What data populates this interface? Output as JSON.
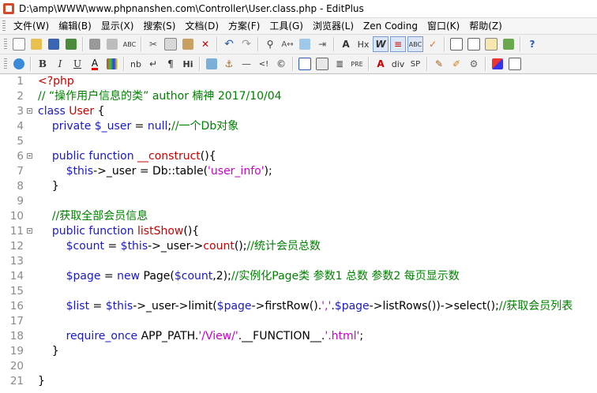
{
  "window": {
    "title": "D:\\amp\\WWW\\www.phpnanshen.com\\Controller\\User.class.php - EditPlus"
  },
  "menu": [
    {
      "label": "文件(W)"
    },
    {
      "label": "编辑(B)"
    },
    {
      "label": "显示(X)"
    },
    {
      "label": "搜索(S)"
    },
    {
      "label": "文档(D)"
    },
    {
      "label": "方案(F)"
    },
    {
      "label": "工具(G)"
    },
    {
      "label": "浏览器(L)"
    },
    {
      "label": "Zen Coding"
    },
    {
      "label": "窗口(K)"
    },
    {
      "label": "帮助(Z)"
    }
  ],
  "toolbar1": [
    "new-file-icon",
    "open-file-icon",
    "save-icon",
    "save-all-icon",
    "sep",
    "print-icon",
    "print-preview-icon",
    "spell-check-icon",
    "sep",
    "cut-icon",
    "copy-icon",
    "paste-icon",
    "delete-icon",
    "sep",
    "undo-icon",
    "redo-icon",
    "sep",
    "find-icon",
    "replace-icon",
    "find-in-files-icon",
    "goto-icon",
    "sep",
    "font-size-icon",
    "hx-icon",
    "word-wrap-icon",
    "indent-icon",
    "column-icon",
    "check-icon",
    "sep",
    "document-list-icon",
    "output-window-icon",
    "cliptext-icon",
    "directory-icon",
    "sep",
    "help-icon"
  ],
  "toolbar2": [
    "browser-icon",
    "sep",
    "bold-icon",
    "italic-icon",
    "underline-icon",
    "font-color-icon",
    "color-picker-icon",
    "sep",
    "nbsp-icon",
    "br-icon",
    "paragraph-icon",
    "heading-icon",
    "sep",
    "image-icon",
    "anchor-icon",
    "hr-icon",
    "comment-icon",
    "copyright-icon",
    "sep",
    "table-icon",
    "form-icon",
    "list-icon",
    "pre-icon",
    "sep",
    "quote-icon",
    "div-icon",
    "span-icon",
    "sep",
    "edit-icon",
    "marker-icon",
    "plugin-icon",
    "sep",
    "color-chooser-icon",
    "view-icon"
  ],
  "toolbar_text": {
    "bold": "B",
    "italic": "I",
    "underline": "U",
    "font_color": "A",
    "nbsp": "nb",
    "br": "↵",
    "paragraph": "¶",
    "heading": "Hi",
    "hx": "Hx",
    "pre": "PRE",
    "quote": "A",
    "div": "div",
    "span": "SP",
    "font_size": "A",
    "abc": "ABC"
  },
  "editor": {
    "lines": [
      {
        "n": "1",
        "fold": false,
        "html": "<span class=\"op\">&lt;?php</span>"
      },
      {
        "n": "2",
        "fold": false,
        "html": "<span class=\"cm\">// “操作用户信息的类” author 楠神 2017/10/04</span>"
      },
      {
        "n": "3",
        "fold": true,
        "html": "<span class=\"kw\">class</span> <span class=\"fn\">User</span> {"
      },
      {
        "n": "4",
        "fold": false,
        "html": "    <span class=\"kw\">private</span> <span class=\"var\">$_user</span> = <span class=\"kw\">null</span>;<span class=\"cm\">//一个Db对象</span>"
      },
      {
        "n": "5",
        "fold": false,
        "html": ""
      },
      {
        "n": "6",
        "fold": true,
        "html": "    <span class=\"kw\">public function</span> <span class=\"fn\">__construct</span>(){"
      },
      {
        "n": "7",
        "fold": false,
        "html": "        <span class=\"var\">$this</span>-&gt;_user = Db::table(<span class=\"str\">'user_info'</span>);"
      },
      {
        "n": "8",
        "fold": false,
        "html": "    }"
      },
      {
        "n": "9",
        "fold": false,
        "html": ""
      },
      {
        "n": "10",
        "fold": false,
        "html": "    <span class=\"cm\">//获取全部会员信息</span>"
      },
      {
        "n": "11",
        "fold": true,
        "html": "    <span class=\"kw\">public function</span> <span class=\"fn\">listShow</span>(){"
      },
      {
        "n": "12",
        "fold": false,
        "html": "        <span class=\"var\">$count</span> = <span class=\"var\">$this</span>-&gt;_user-&gt;<span class=\"fn\">count</span>();<span class=\"cm\">//统计会员总数</span>"
      },
      {
        "n": "13",
        "fold": false,
        "html": ""
      },
      {
        "n": "14",
        "fold": false,
        "html": "        <span class=\"var\">$page</span> = <span class=\"kw\">new</span> Page(<span class=\"var\">$count</span>,2);<span class=\"cm\">//实例化Page类 参数1 总数 参数2 每页显示数</span>"
      },
      {
        "n": "15",
        "fold": false,
        "html": ""
      },
      {
        "n": "16",
        "fold": false,
        "html": "        <span class=\"var\">$list</span> = <span class=\"var\">$this</span>-&gt;_user-&gt;limit(<span class=\"var\">$page</span>-&gt;firstRow().<span class=\"str\">','</span>.<span class=\"var\">$page</span>-&gt;listRows())-&gt;select();<span class=\"cm\">//获取会员列表</span>"
      },
      {
        "n": "17",
        "fold": false,
        "html": ""
      },
      {
        "n": "18",
        "fold": false,
        "html": "        <span class=\"kw\">require_once</span> APP_PATH.<span class=\"str\">'/View/'</span>.__FUNCTION__.<span class=\"str\">'.html'</span>;"
      },
      {
        "n": "19",
        "fold": false,
        "html": "    }"
      },
      {
        "n": "20",
        "fold": false,
        "html": ""
      },
      {
        "n": "21",
        "fold": false,
        "html": "}"
      }
    ]
  }
}
